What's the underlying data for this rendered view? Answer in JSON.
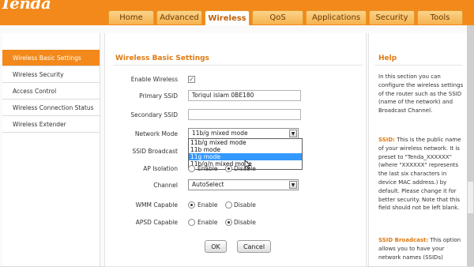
{
  "brand": {
    "logo": "Tenda"
  },
  "nav": {
    "tabs": [
      {
        "label": "Home",
        "active": false
      },
      {
        "label": "Advanced",
        "active": false
      },
      {
        "label": "Wireless",
        "active": true
      },
      {
        "label": "QoS",
        "active": false
      },
      {
        "label": "Applications",
        "active": false
      },
      {
        "label": "Security",
        "active": false
      },
      {
        "label": "Tools",
        "active": false
      }
    ]
  },
  "sidebar": {
    "items": [
      {
        "label": "Wireless Basic Settings",
        "active": true
      },
      {
        "label": "Wireless Security",
        "active": false
      },
      {
        "label": "Access Control",
        "active": false
      },
      {
        "label": "Wireless Connection Status",
        "active": false
      },
      {
        "label": "Wireless Extender",
        "active": false
      }
    ]
  },
  "main": {
    "title": "Wireless Basic Settings",
    "enable_wireless": {
      "label": "Enable Wireless",
      "checked": true
    },
    "primary_ssid": {
      "label": "Primary SSID",
      "value": "Toriqul islam 0BE180"
    },
    "secondary_ssid": {
      "label": "Secondary SSID",
      "value": ""
    },
    "network_mode": {
      "label": "Network Mode",
      "value": "11b/g mixed mode",
      "options": [
        "11b/g mixed mode",
        "11b mode",
        "11g mode",
        "11b/g/n mixed mode"
      ],
      "highlighted": "11g mode"
    },
    "ssid_broadcast": {
      "label": "SSID Broadcast"
    },
    "ap_isolation": {
      "label": "AP Isolation",
      "enable": "Enable",
      "disable": "Disable",
      "selected": "Disable"
    },
    "channel": {
      "label": "Channel",
      "value": "AutoSelect"
    },
    "wmm": {
      "label": "WMM Capable",
      "enable": "Enable",
      "disable": "Disable",
      "selected": "Enable"
    },
    "apsd": {
      "label": "APSD Capable",
      "enable": "Enable",
      "disable": "Disable",
      "selected": "Disable"
    },
    "ok_label": "OK",
    "cancel_label": "Cancel"
  },
  "help": {
    "title": "Help",
    "intro": "In this section you can configure the wireless settings of the router such as the SSID (name of the network) and Broadcast Channel.",
    "ssid_term": "SSID:",
    "ssid_text": "This is the public name of your wireless network. It is preset to \"Tenda_XXXXXX\" (where \"XXXXXX\" represents the last six characters in device MAC address.) by default. Please change it for better security. Note that this field should not be left blank.",
    "broadcast_term": "SSID Broadcast:",
    "broadcast_text": "This option allows you to have your network names (SSIDs)"
  },
  "colors": {
    "brand_orange": "#f2891a",
    "highlight_blue": "#3399ff"
  },
  "icons": {
    "checkmark": "check-icon",
    "dropdown": "chevron-down-icon",
    "cursor": "mouse-cursor-icon"
  }
}
